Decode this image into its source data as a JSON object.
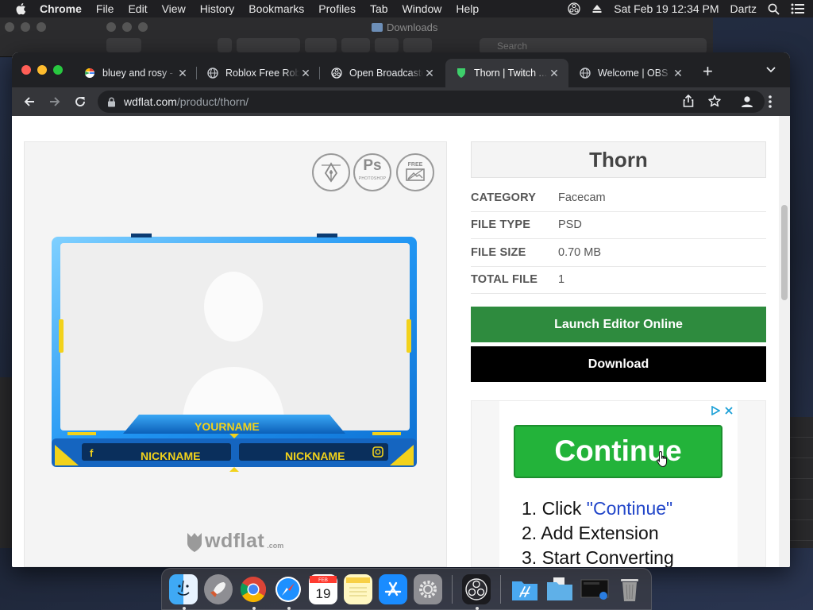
{
  "menubar": {
    "app": "Chrome",
    "items": [
      "File",
      "Edit",
      "View",
      "History",
      "Bookmarks",
      "Profiles",
      "Tab",
      "Window",
      "Help"
    ],
    "clock": "Sat Feb 19  12:34 PM",
    "user": "Dartz"
  },
  "finder": {
    "title": "Downloads",
    "search_placeholder": "Search"
  },
  "tabs": [
    {
      "title": "bluey and rosy -",
      "favicon": "google-icon"
    },
    {
      "title": "Roblox Free Robux",
      "favicon": "globe-icon"
    },
    {
      "title": "Open Broadcaster",
      "favicon": "obs-icon"
    },
    {
      "title": "Thorn | Twitch ...",
      "favicon": "wdflat-icon",
      "active": true
    },
    {
      "title": "Welcome | OBS",
      "favicon": "globe-icon"
    }
  ],
  "address": {
    "host": "wdflat.com",
    "path": "/product/thorn/"
  },
  "product": {
    "title": "Thorn",
    "specs": [
      {
        "key": "CATEGORY",
        "value": "Facecam"
      },
      {
        "key": "FILE TYPE",
        "value": "PSD"
      },
      {
        "key": "FILE SIZE",
        "value": "0.70 MB"
      },
      {
        "key": "TOTAL FILE",
        "value": "1"
      }
    ],
    "launch_label": "Launch Editor Online",
    "download_label": "Download"
  },
  "preview": {
    "badge_ps": "Ps",
    "badge_ps_sub": "PHOTOSHOP",
    "badge_free": "FREE",
    "overlay_yourname": "YOURNAME",
    "overlay_nickname_left": "NICKNAME",
    "overlay_nickname_right": "NICKNAME",
    "brand_word": "wdflat",
    "brand_tld": ".com"
  },
  "ad": {
    "button": "Continue",
    "step1_prefix": "1. Click ",
    "step1_link": "\"Continue\"",
    "step2": "2. Add Extension",
    "step3": "3. Start Converting"
  },
  "colors": {
    "launch_green": "#2e8b3e",
    "ad_green": "#23b33a",
    "overlay_blue": "#1e88e5",
    "overlay_gold": "#f2d21b"
  }
}
